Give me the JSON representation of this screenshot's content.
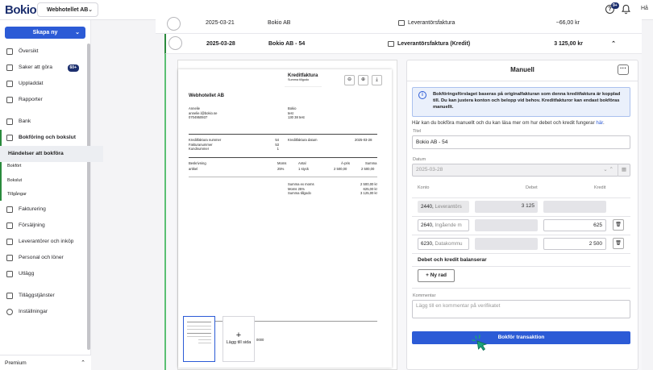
{
  "brand": {
    "logo": "Bokio",
    "accent": "#2c5bd6",
    "navy": "#1c2f6e",
    "green": "#2a8a3c"
  },
  "header": {
    "company": "Webhotellet AB",
    "notif_badge": "9+",
    "user": "Hå"
  },
  "sidebar": {
    "new_button": "Skapa ny",
    "items": [
      {
        "label": "Översikt",
        "icon": "home-icon"
      },
      {
        "label": "Saker att göra",
        "icon": "checklist-icon",
        "badge": "60+"
      },
      {
        "label": "Uppladdat",
        "icon": "folder-icon"
      },
      {
        "label": "Rapporter",
        "icon": "report-icon"
      },
      {
        "label": "Bank",
        "icon": "bank-icon"
      },
      {
        "label": "Bokföring och bokslut",
        "icon": "ledger-icon"
      },
      {
        "label": "Fakturering",
        "icon": "invoice-icon"
      },
      {
        "label": "Försäljning",
        "icon": "cart-icon"
      },
      {
        "label": "Leverantörer och inköp",
        "icon": "supplier-icon"
      },
      {
        "label": "Personal och löner",
        "icon": "people-icon"
      },
      {
        "label": "Utlägg",
        "icon": "expense-icon"
      },
      {
        "label": "Tilläggstjänster",
        "icon": "addon-icon"
      },
      {
        "label": "Inställningar",
        "icon": "settings-icon"
      }
    ],
    "subitems": [
      "Händelser att bokföra",
      "Bokfört",
      "Bokslut",
      "Tillgångar"
    ],
    "plan": "Premium"
  },
  "rows": [
    {
      "date": "2025-03-21",
      "name": "Bokio AB",
      "type": "Leverantörsfaktura",
      "amount": "−66,00 kr"
    },
    {
      "date": "2025-03-28",
      "name": "Bokio AB - 54",
      "type": "Leverantörsfaktura (Kredit)",
      "amount": "3 125,00 kr"
    }
  ],
  "document": {
    "title": "Kreditfaktura",
    "subtitle": "Summa tillgodo",
    "seller": "Webhotellet AB",
    "buyer_name": "Annelie",
    "buyer_email": "annelie.l@bokio.se",
    "buyer_phone": "0704950937",
    "rec_name": "Bokio",
    "rec_street": "test",
    "rec_city": "130 38 test",
    "meta_labels": [
      "Kreditfaktura nummer",
      "Fakturanummer",
      "Kundnummer"
    ],
    "meta_values": [
      "54",
      "53",
      "1"
    ],
    "date_label": "Kreditfaktura datum",
    "date_value": "2025-03-28",
    "cols": [
      "Beskrivning",
      "Moms",
      "Antal",
      "Á-pris",
      "Summa"
    ],
    "line": [
      "artikel",
      "25%",
      "1 styck",
      "2 500,00",
      "2 500,00"
    ],
    "tot_labels": [
      "Summa ex moms",
      "Moms 25%",
      "Summa tillgodo"
    ],
    "tot_values": [
      "2 500,00 kr",
      "625,00 kr",
      "3 125,00 kr"
    ],
    "footer_frag": "0000",
    "add_page": "Lägg till sida"
  },
  "manual": {
    "title": "Manuell",
    "info": "Bokföringsförslaget baseras på originalfakturan som denna kreditfaktura är kopplad till. Du kan justera konton och belopp vid behov. Kreditfakturor kan endast bokföras manuellt.",
    "help_text": "Här kan du bokföra manuellt och du kan läsa mer om hur debet och kredit fungerar",
    "help_link": "här",
    "title_label": "Titel",
    "title_value": "Bokio AB - 54",
    "date_label": "Datum",
    "date_value": "2025-03-28",
    "col_konto": "Konto",
    "col_debet": "Debet",
    "col_kredit": "Kredit",
    "lines": [
      {
        "acct": "2440",
        "name": "Leverantörs",
        "debet": "3 125",
        "kredit": ""
      },
      {
        "acct": "2640",
        "name": "Ingående m",
        "debet": "",
        "kredit": "625"
      },
      {
        "acct": "6230",
        "name": "Datakommu",
        "debet": "",
        "kredit": "2 500"
      }
    ],
    "balance_text": "Debet och kredit balanserar",
    "add_row": "Ny rad",
    "comment_label": "Kommentar",
    "comment_placeholder": "Lägg till en kommentar på verifikatet",
    "submit": "Bokför transaktion"
  }
}
